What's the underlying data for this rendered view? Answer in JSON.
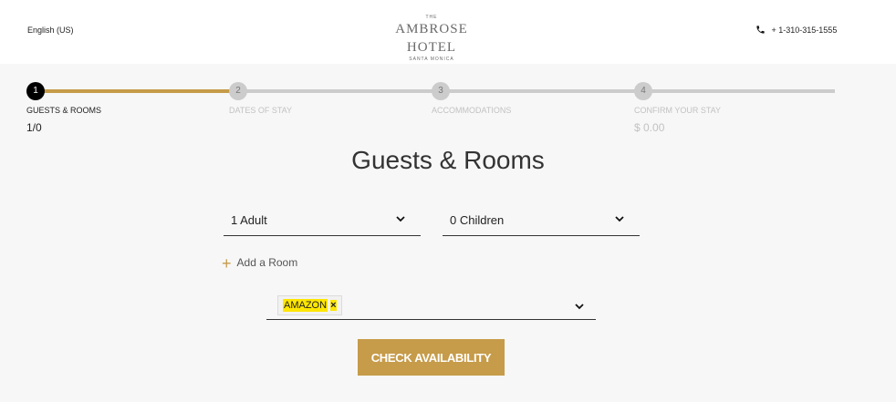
{
  "header": {
    "language": "English (US)",
    "logo_top": "THE",
    "logo_main": "AMBROSE HOTEL",
    "logo_bottom": "SANTA MONICA",
    "phone": "+ 1-310-315-1555"
  },
  "steps": [
    {
      "num": "1",
      "label": "GUESTS & ROOMS",
      "sub": "1/0",
      "active": true
    },
    {
      "num": "2",
      "label": "DATES OF STAY",
      "sub": "",
      "active": false
    },
    {
      "num": "3",
      "label": "ACCOMMODATIONS",
      "sub": "",
      "active": false
    },
    {
      "num": "4",
      "label": "CONFIRM YOUR STAY",
      "sub": "$ 0.00",
      "active": false
    }
  ],
  "main": {
    "title": "Guests & Rooms",
    "adults_value": "1 Adult",
    "children_value": "0 Children",
    "add_room_label": "Add a Room",
    "promo_tag": "AMAZON",
    "promo_tag_remove": "×",
    "check_button": "CHECK AVAILABILITY"
  },
  "colors": {
    "accent": "#c69b49",
    "highlight": "#ffe600",
    "inactive": "#cccccc",
    "active_step": "#000000"
  },
  "icons": {
    "phone": "phone-icon",
    "chevron": "chevron-down-icon",
    "plus": "plus-icon",
    "remove": "close-icon"
  }
}
